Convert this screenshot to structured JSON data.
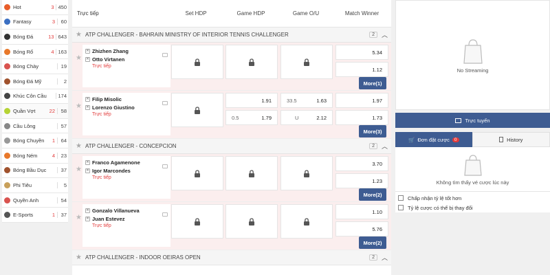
{
  "sidebar": {
    "items": [
      {
        "label": "Hot",
        "live": "3",
        "count": "450",
        "icon": "flame-icon",
        "color": "#e85d2a"
      },
      {
        "label": "Fantasy",
        "live": "3",
        "count": "60",
        "icon": "fantasy-icon",
        "color": "#3a6fc2"
      },
      {
        "label": "Bóng Đá",
        "live": "13",
        "count": "643",
        "icon": "soccer-ball-icon",
        "color": "#333333"
      },
      {
        "label": "Bóng Rổ",
        "live": "4",
        "count": "163",
        "icon": "basketball-icon",
        "color": "#e8782a"
      },
      {
        "label": "Bóng Chày",
        "live": "",
        "count": "19",
        "icon": "baseball-icon",
        "color": "#d9534f"
      },
      {
        "label": "Bóng Đá Mỹ",
        "live": "",
        "count": "2",
        "icon": "american-football-icon",
        "color": "#a0522d"
      },
      {
        "label": "Khúc Côn Cầu",
        "live": "",
        "count": "174",
        "icon": "hockey-stick-icon",
        "color": "#444444"
      },
      {
        "label": "Quần Vợt",
        "live": "22",
        "count": "58",
        "icon": "tennis-ball-icon",
        "color": "#b5d334"
      },
      {
        "label": "Cầu Lông",
        "live": "",
        "count": "57",
        "icon": "shuttlecock-icon",
        "color": "#888888"
      },
      {
        "label": "Bóng Chuyền",
        "live": "1",
        "count": "64",
        "icon": "volleyball-icon",
        "color": "#999999"
      },
      {
        "label": "Bóng Ném",
        "live": "4",
        "count": "23",
        "icon": "handball-icon",
        "color": "#e8782a"
      },
      {
        "label": "Bóng Bầu Dục",
        "live": "",
        "count": "37",
        "icon": "rugby-ball-icon",
        "color": "#a0522d"
      },
      {
        "label": "Phi Tiêu",
        "live": "",
        "count": "5",
        "icon": "dart-icon",
        "color": "#c8a05a"
      },
      {
        "label": "Quyền Anh",
        "live": "",
        "count": "54",
        "icon": "boxing-glove-icon",
        "color": "#d9534f"
      },
      {
        "label": "E-Sports",
        "live": "1",
        "count": "37",
        "icon": "esports-icon",
        "color": "#555555"
      }
    ]
  },
  "header": {
    "live_label": "Trực tiếp",
    "columns": [
      "Set HDP",
      "Game HDP",
      "Game O/U",
      "Match Winner"
    ]
  },
  "leagues": [
    {
      "name": "ATP CHALLENGER - BAHRAIN MINISTRY OF INTERIOR TENNIS CHALLENGER",
      "count": "2"
    },
    {
      "name": "ATP CHALLENGER - CONCEPCION",
      "count": "2"
    },
    {
      "name": "ATP CHALLENGER - INDOOR OEIRAS OPEN",
      "count": "2"
    }
  ],
  "matches": [
    {
      "home": "Zhizhen Zhang",
      "away": "Otto Virtanen",
      "status": "Trực tiếp",
      "mw_home": "5.34",
      "mw_away": "1.12",
      "more": "More(1)",
      "g_hdp": null,
      "g_ou": null
    },
    {
      "home": "Filip Misolic",
      "away": "Lorenzo Giustino",
      "status": "Trực tiếp",
      "mw_home": "1.97",
      "mw_away": "1.73",
      "more": "More(3)",
      "g_hdp": {
        "home_odds": "1.91",
        "away_hc": "0.5",
        "away_odds": "1.79"
      },
      "g_ou": {
        "line": "33.5",
        "over": "1.63",
        "under_label": "U",
        "under": "2.12"
      }
    },
    {
      "home": "Franco Agamenone",
      "away": "Igor Marcondes",
      "status": "Trực tiếp",
      "mw_home": "3.70",
      "mw_away": "1.23",
      "more": "More(2)",
      "g_hdp": null,
      "g_ou": null
    },
    {
      "home": "Gonzalo Villanueva",
      "away": "Juan Estevez",
      "status": "Trực tiếp",
      "mw_home": "1.10",
      "mw_away": "5.76",
      "more": "More(2)",
      "g_hdp": null,
      "g_ou": null
    }
  ],
  "right": {
    "no_streaming": "No Streaming",
    "online_label": "Trực tuyến",
    "tab_slip": "Đơn đặt cược",
    "tab_slip_badge": "0",
    "tab_history": "History",
    "empty_msg": "Không tìm thấy vé cược lúc này",
    "options": [
      "Chấp nhận tỷ lệ tốt hơn",
      "Tỷ lệ cược có thể bị thay đổi"
    ]
  },
  "colors": {
    "accent": "#3e5c92",
    "live_red": "#e23b3b"
  }
}
